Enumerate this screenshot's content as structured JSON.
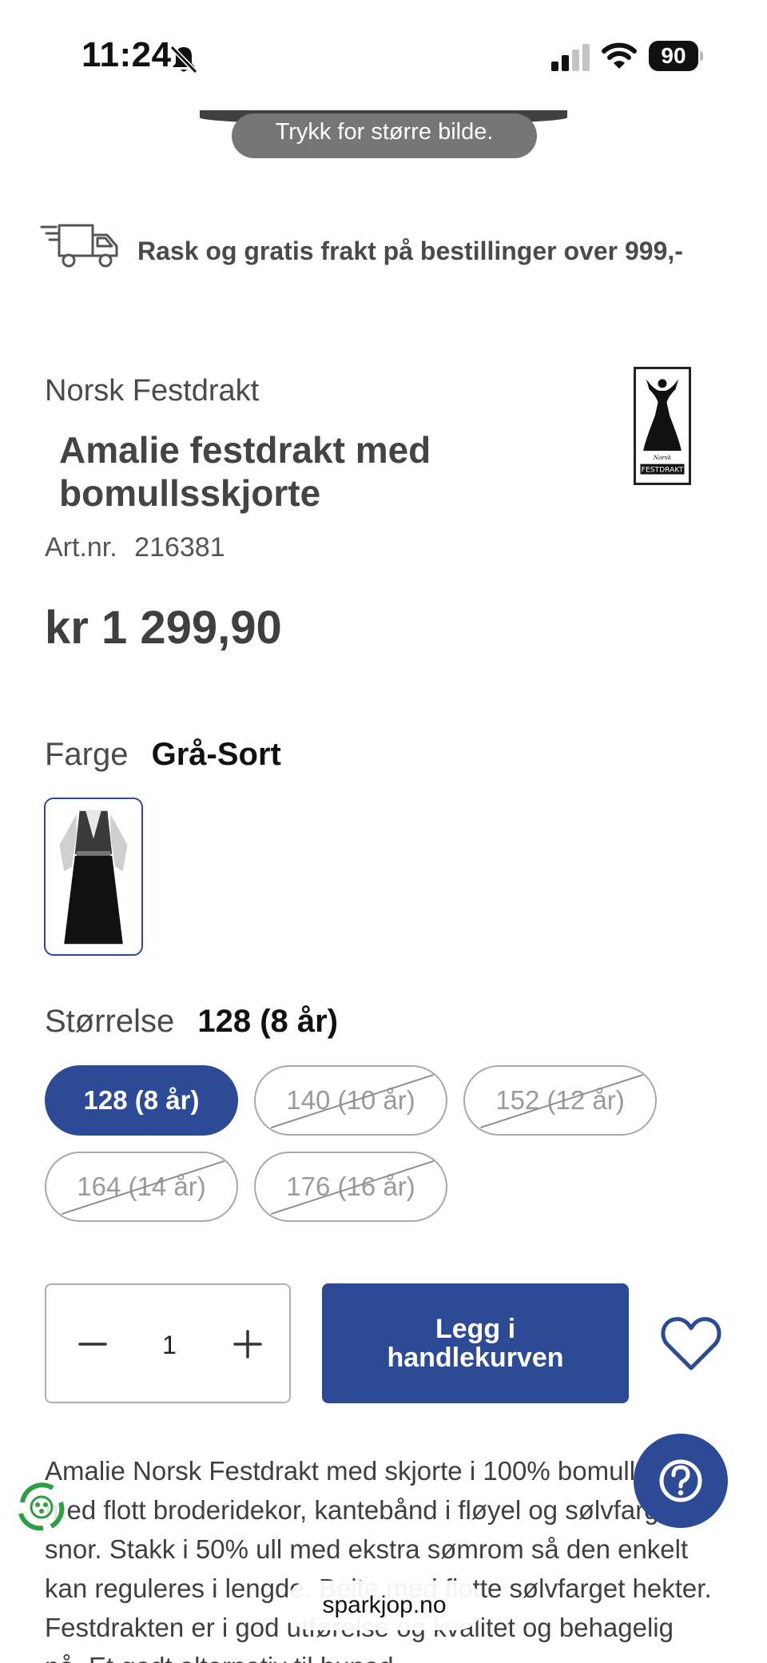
{
  "status_bar": {
    "time": "11:24",
    "battery": "90"
  },
  "image_hint": "Trykk for større bilde.",
  "shipping": {
    "text": "Rask og gratis frakt på bestillinger over 999,-"
  },
  "product": {
    "brand": "Norsk Festdrakt",
    "title": "Amalie festdrakt med bomullsskjorte",
    "art_label": "Art.nr.",
    "art_number": "216381",
    "price": "kr 1 299,90"
  },
  "color": {
    "label": "Farge",
    "value": "Grå-Sort"
  },
  "size": {
    "label": "Størrelse",
    "value": "128 (8 år)",
    "options": [
      {
        "label": "128 (8 år)",
        "state": "selected"
      },
      {
        "label": "140 (10 år)",
        "state": "unavailable"
      },
      {
        "label": "152 (12 år)",
        "state": "unavailable"
      },
      {
        "label": "164 (14 år)",
        "state": "unavailable"
      },
      {
        "label": "176 (16 år)",
        "state": "unavailable"
      }
    ]
  },
  "cart": {
    "quantity": "1",
    "add_label": "Legg i handlekurven"
  },
  "description": "Amalie Norsk Festdrakt med skjorte i 100% bomull. Vest med flott broderidekor, kantebånd i fløyel og sølvfarget snor. Stakk i 50% ull med ekstra sømrom så den enkelt kan reguleres i lengde. Belte med flotte sølvfarget hekter. Festdrakten er i god utførelse og kvalitet og behagelig på. Et godt alternativ til bunad.",
  "domain": "sparkjop.no",
  "icons": {
    "bell": "bell-slash-icon",
    "truck": "delivery-truck-icon",
    "heart": "heart-outline-icon",
    "help": "question-mark-icon",
    "eco": "recycle-badge-icon"
  },
  "colors": {
    "accent": "#2c4a96",
    "text": "#3f3f3f"
  }
}
